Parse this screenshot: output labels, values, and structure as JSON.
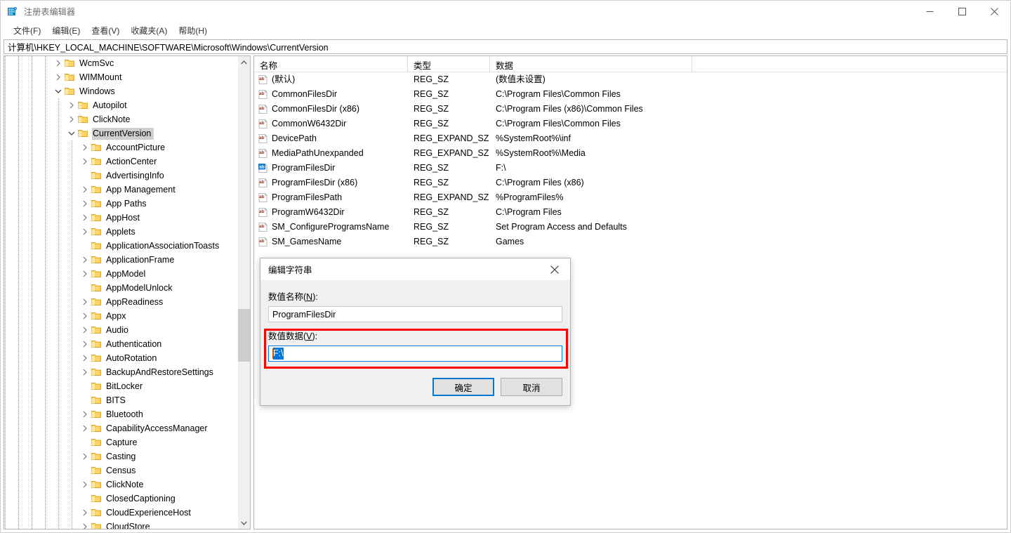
{
  "window": {
    "title": "注册表编辑器",
    "icon": "registry-editor-icon",
    "minimize_label": "最小化",
    "maximize_label": "最大化",
    "close_label": "关闭"
  },
  "menubar": {
    "items": [
      {
        "label": "文件(F)"
      },
      {
        "label": "编辑(E)"
      },
      {
        "label": "查看(V)"
      },
      {
        "label": "收藏夹(A)"
      },
      {
        "label": "帮助(H)"
      }
    ]
  },
  "address": {
    "value": "计算机\\HKEY_LOCAL_MACHINE\\SOFTWARE\\Microsoft\\Windows\\CurrentVersion"
  },
  "tree": {
    "scroll_up_icon": "chevron-up-icon",
    "scroll_down_icon": "chevron-down-icon",
    "items": [
      {
        "label": "WcmSvc",
        "depth": 3,
        "state": "collapsed",
        "selected": false
      },
      {
        "label": "WIMMount",
        "depth": 3,
        "state": "collapsed",
        "selected": false
      },
      {
        "label": "Windows",
        "depth": 3,
        "state": "expanded",
        "selected": false
      },
      {
        "label": "Autopilot",
        "depth": 4,
        "state": "collapsed",
        "selected": false
      },
      {
        "label": "ClickNote",
        "depth": 4,
        "state": "collapsed",
        "selected": false
      },
      {
        "label": "CurrentVersion",
        "depth": 4,
        "state": "expanded",
        "selected": true
      },
      {
        "label": "AccountPicture",
        "depth": 5,
        "state": "collapsed",
        "selected": false
      },
      {
        "label": "ActionCenter",
        "depth": 5,
        "state": "collapsed",
        "selected": false
      },
      {
        "label": "AdvertisingInfo",
        "depth": 5,
        "state": "leaf",
        "selected": false
      },
      {
        "label": "App Management",
        "depth": 5,
        "state": "collapsed",
        "selected": false
      },
      {
        "label": "App Paths",
        "depth": 5,
        "state": "collapsed",
        "selected": false
      },
      {
        "label": "AppHost",
        "depth": 5,
        "state": "collapsed",
        "selected": false
      },
      {
        "label": "Applets",
        "depth": 5,
        "state": "collapsed",
        "selected": false
      },
      {
        "label": "ApplicationAssociationToasts",
        "depth": 5,
        "state": "leaf",
        "selected": false
      },
      {
        "label": "ApplicationFrame",
        "depth": 5,
        "state": "collapsed",
        "selected": false
      },
      {
        "label": "AppModel",
        "depth": 5,
        "state": "collapsed",
        "selected": false
      },
      {
        "label": "AppModelUnlock",
        "depth": 5,
        "state": "leaf",
        "selected": false
      },
      {
        "label": "AppReadiness",
        "depth": 5,
        "state": "collapsed",
        "selected": false
      },
      {
        "label": "Appx",
        "depth": 5,
        "state": "collapsed",
        "selected": false
      },
      {
        "label": "Audio",
        "depth": 5,
        "state": "collapsed",
        "selected": false
      },
      {
        "label": "Authentication",
        "depth": 5,
        "state": "collapsed",
        "selected": false
      },
      {
        "label": "AutoRotation",
        "depth": 5,
        "state": "collapsed",
        "selected": false
      },
      {
        "label": "BackupAndRestoreSettings",
        "depth": 5,
        "state": "collapsed",
        "selected": false
      },
      {
        "label": "BitLocker",
        "depth": 5,
        "state": "leaf",
        "selected": false
      },
      {
        "label": "BITS",
        "depth": 5,
        "state": "leaf",
        "selected": false
      },
      {
        "label": "Bluetooth",
        "depth": 5,
        "state": "collapsed",
        "selected": false
      },
      {
        "label": "CapabilityAccessManager",
        "depth": 5,
        "state": "collapsed",
        "selected": false
      },
      {
        "label": "Capture",
        "depth": 5,
        "state": "leaf",
        "selected": false
      },
      {
        "label": "Casting",
        "depth": 5,
        "state": "collapsed",
        "selected": false
      },
      {
        "label": "Census",
        "depth": 5,
        "state": "leaf",
        "selected": false
      },
      {
        "label": "ClickNote",
        "depth": 5,
        "state": "collapsed",
        "selected": false
      },
      {
        "label": "ClosedCaptioning",
        "depth": 5,
        "state": "leaf",
        "selected": false
      },
      {
        "label": "CloudExperienceHost",
        "depth": 5,
        "state": "collapsed",
        "selected": false
      },
      {
        "label": "CloudStore",
        "depth": 5,
        "state": "collapsed",
        "selected": false
      }
    ]
  },
  "list": {
    "columns": [
      {
        "label": "名称"
      },
      {
        "label": "类型"
      },
      {
        "label": "数据"
      }
    ],
    "rows": [
      {
        "name": "(默认)",
        "type": "REG_SZ",
        "data": "(数值未设置)",
        "selected": false
      },
      {
        "name": "CommonFilesDir",
        "type": "REG_SZ",
        "data": "C:\\Program Files\\Common Files",
        "selected": false
      },
      {
        "name": "CommonFilesDir (x86)",
        "type": "REG_SZ",
        "data": "C:\\Program Files (x86)\\Common Files",
        "selected": false
      },
      {
        "name": "CommonW6432Dir",
        "type": "REG_SZ",
        "data": "C:\\Program Files\\Common Files",
        "selected": false
      },
      {
        "name": "DevicePath",
        "type": "REG_EXPAND_SZ",
        "data": "%SystemRoot%\\inf",
        "selected": false
      },
      {
        "name": "MediaPathUnexpanded",
        "type": "REG_EXPAND_SZ",
        "data": "%SystemRoot%\\Media",
        "selected": false
      },
      {
        "name": "ProgramFilesDir",
        "type": "REG_SZ",
        "data": "F:\\",
        "selected": true
      },
      {
        "name": "ProgramFilesDir (x86)",
        "type": "REG_SZ",
        "data": "C:\\Program Files (x86)",
        "selected": false
      },
      {
        "name": "ProgramFilesPath",
        "type": "REG_EXPAND_SZ",
        "data": "%ProgramFiles%",
        "selected": false
      },
      {
        "name": "ProgramW6432Dir",
        "type": "REG_SZ",
        "data": "C:\\Program Files",
        "selected": false
      },
      {
        "name": "SM_ConfigureProgramsName",
        "type": "REG_SZ",
        "data": "Set Program Access and Defaults",
        "selected": false
      },
      {
        "name": "SM_GamesName",
        "type": "REG_SZ",
        "data": "Games",
        "selected": false
      }
    ]
  },
  "dialog": {
    "title": "编辑字符串",
    "close_icon": "close-icon",
    "name_label_prefix": "数值名称(",
    "name_label_key": "N",
    "name_label_suffix": "):",
    "name_value": "ProgramFilesDir",
    "data_label_prefix": "数值数据(",
    "data_label_key": "V",
    "data_label_suffix": "):",
    "data_value": "F:\\",
    "ok_label": "确定",
    "cancel_label": "取消"
  },
  "annotation": {
    "highlight_color": "#ff0000",
    "accent_color": "#0078d7"
  }
}
